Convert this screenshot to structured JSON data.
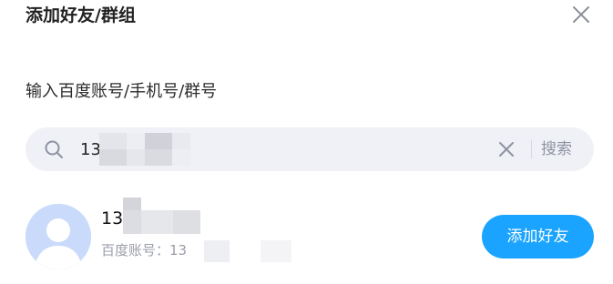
{
  "dialog": {
    "title": "添加好友/群组",
    "close_icon": "close-icon"
  },
  "instruction": "输入百度账号/手机号/群号",
  "search": {
    "icon": "search-icon",
    "value": "13",
    "clear_icon": "clear-icon",
    "button_label": "搜索"
  },
  "result": {
    "avatar": "default-avatar",
    "name": "13",
    "id_label": "百度账号：13",
    "add_button_label": "添加好友"
  },
  "colors": {
    "accent": "#1aa3ff",
    "search_bg": "#f0f1f6",
    "avatar_bg": "#c9dafb",
    "muted_text": "#9a9ea8"
  }
}
